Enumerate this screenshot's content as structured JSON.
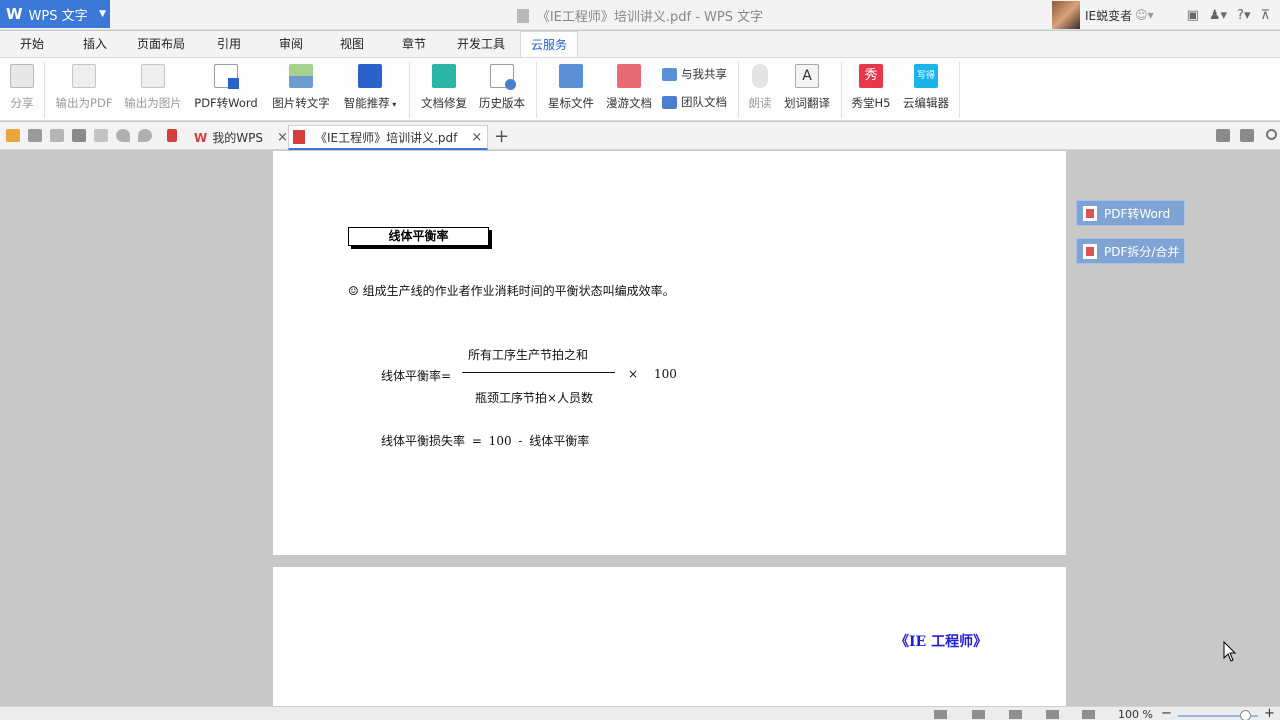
{
  "app": {
    "button_label": "WPS 文字",
    "window_title": "《IE工程师》培训讲义.pdf - WPS 文字",
    "user_name": "IE蜕变者"
  },
  "menu_tabs": [
    "开始",
    "插入",
    "页面布局",
    "引用",
    "审阅",
    "视图",
    "章节",
    "开发工具",
    "云服务"
  ],
  "active_menu_tab": "云服务",
  "ribbon": {
    "share": "分享",
    "export_pdf": "输出为PDF",
    "export_image": "输出为图片",
    "pdf_to_word": "PDF转Word",
    "image_to_text": "图片转文字",
    "smart_recommend": "智能推荐",
    "doc_repair": "文档修复",
    "history": "历史版本",
    "starred_files": "星标文件",
    "roaming_docs": "漫游文档",
    "shared_with_me": "与我共享",
    "team_docs": "团队文档",
    "read_aloud": "朗读",
    "word_translate": "划词翻译",
    "xiutang_h5": "秀堂H5",
    "cloud_editor": "云编辑器"
  },
  "tabs": {
    "home": "我的WPS",
    "doc": "《IE工程师》培训讲义.pdf"
  },
  "document": {
    "section_title": "线体平衡率",
    "definition": "☺ 组成生产线的作业者作业消耗时间的平衡状态叫编成效率。",
    "formula_lhs": "线体平衡率=",
    "numerator": "所有工序生产节拍之和",
    "denominator": "瓶颈工序节拍×人员数",
    "times": "×",
    "multiplier": "100",
    "loss_formula": "线体平衡损失率 = 100 - 线体平衡率",
    "page2_header": "《IE 工程师》"
  },
  "side_panel": {
    "pdf_to_word": "PDF转Word",
    "pdf_split_merge": "PDF拆分/合并"
  },
  "status": {
    "zoom": "100 %"
  }
}
